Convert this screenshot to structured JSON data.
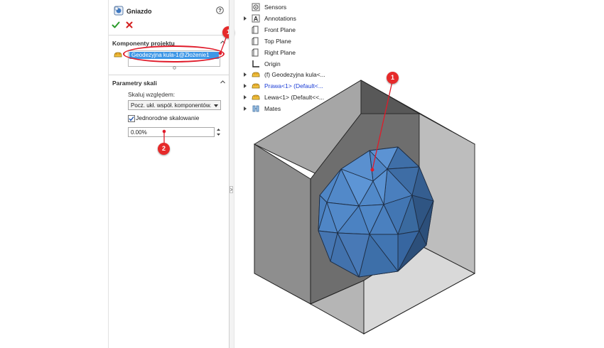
{
  "panel": {
    "title": "Gniazdo",
    "section_components": "Komponenty projektu",
    "selected_component": "Geodezyjna kula-1@Złożenie1",
    "section_scale": "Parametry skali",
    "scale_about_label": "Skaluj względem:",
    "scale_about_value": "Pocz. ukł. współ. komponentów.",
    "uniform_scaling_label": "Jednorodne skalowanie",
    "uniform_scaling_checked": true,
    "scale_value": "0.00%"
  },
  "annotations": {
    "badge_1": "1",
    "badge_2": "2",
    "badge_3": "1",
    "color": "#e62a2a"
  },
  "tree": {
    "items": [
      {
        "label": "Sensors",
        "icon": "sensor-icon",
        "expandable": false
      },
      {
        "label": "Annotations",
        "icon": "annotations-icon",
        "expandable": true
      },
      {
        "label": "Front Plane",
        "icon": "plane-icon",
        "expandable": false
      },
      {
        "label": "Top Plane",
        "icon": "plane-icon",
        "expandable": false
      },
      {
        "label": "Right Plane",
        "icon": "plane-icon",
        "expandable": false
      },
      {
        "label": "Origin",
        "icon": "origin-icon",
        "expandable": false
      },
      {
        "label": "(f) Geodezyjna kula<...",
        "icon": "part-icon",
        "expandable": true
      },
      {
        "label": "Prawa<1> (Default<...",
        "icon": "part-icon",
        "expandable": true,
        "highlight": true
      },
      {
        "label": "Lewa<1> (Default<<...",
        "icon": "part-icon",
        "expandable": true
      },
      {
        "label": "Mates",
        "icon": "mates-icon",
        "expandable": true
      }
    ]
  },
  "colors": {
    "selection": "#3e97e6",
    "ok_green": "#2a9a2a",
    "cancel_red": "#d42020",
    "sphere_blue": "#4f86c6",
    "block_dark": "#8a8a8a",
    "block_light": "#cfcfcf"
  }
}
